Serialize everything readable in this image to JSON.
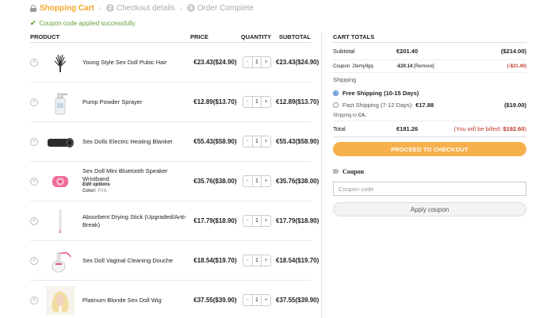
{
  "steps": [
    {
      "num": "1",
      "label": "Shopping Cart"
    },
    {
      "num": "2",
      "label": "Checkout details"
    },
    {
      "num": "3",
      "label": "Order Complete"
    }
  ],
  "step_separator": "›",
  "notice": "Coupon code applied successfully.",
  "cart": {
    "headers": {
      "product": "PRODUCT",
      "price": "PRICE",
      "quantity": "QUANTITY",
      "subtotal": "SUBTOTAL"
    },
    "items": [
      {
        "name": "Young Style Sex Doll Pubic Hair",
        "price": "€23.43($24.90)",
        "qty": "1",
        "subtotal": "€23.43($24.90)",
        "thumb_icon": "feather-tuft-icon"
      },
      {
        "name": "Pump Powder Sprayer",
        "price": "€12.89($13.70)",
        "qty": "1",
        "subtotal": "€12.89($13.70)",
        "thumb_icon": "spray-bottle-icon"
      },
      {
        "name": "Sex Dolls Electric Heating Blanket",
        "price": "€55.43($58.90)",
        "qty": "1",
        "subtotal": "€55.43($58.90)",
        "thumb_icon": "rolled-blanket-icon"
      },
      {
        "name": "Sex Doll Mini Bluetooth Speaker Wristband",
        "edit": "Edit options",
        "meta_label": "Color:",
        "meta_value": "Pink",
        "price": "€35.76($38.00)",
        "qty": "1",
        "subtotal": "€35.76($38.00)",
        "thumb_icon": "pink-wristband-icon"
      },
      {
        "name": "Absorbent Drying Stick (Upgraded/Anti-Break)",
        "price": "€17.79($18.90)",
        "qty": "1",
        "subtotal": "€17.79($18.90)",
        "thumb_icon": "drying-stick-icon"
      },
      {
        "name": "Sex Doll Vaginal Cleaning Douche",
        "price": "€18.54($19.70)",
        "qty": "1",
        "subtotal": "€18.54($19.70)",
        "thumb_icon": "douche-bottle-icon"
      },
      {
        "name": "Platinum Blonde Sex Doll Wig",
        "price": "€37.55($39.90)",
        "qty": "1",
        "subtotal": "€37.55($39.90)",
        "thumb_icon": "blonde-wig-icon"
      }
    ],
    "remove_symbol": "×",
    "minus": "-",
    "plus": "+"
  },
  "totals": {
    "title": "CART TOTALS",
    "subtotal_label": "Subtotal",
    "subtotal_value": "€201.40",
    "subtotal_usd": "($214.00)",
    "coupon_label": "Coupon: 2temy9gq",
    "coupon_value": "-€20.14",
    "coupon_remove": "[Remove]",
    "coupon_usd": "(-$21.40)",
    "shipping_label": "Shipping",
    "free_shipping": "Free Shipping (10-15 Days)",
    "fast_shipping_label": "Fast Shipping (7-12 Days):",
    "fast_shipping_value": "€17.88",
    "fast_shipping_usd": "($19.00)",
    "shipping_to_label": "Shipping to",
    "shipping_to_value": "CA.",
    "total_label": "Total",
    "total_value": "€181.26",
    "billed_label": "(You will be billed:",
    "billed_value": "$192.60",
    "billed_close": ")",
    "checkout_button": "PROCEED TO CHECKOUT",
    "coupon_title": "Coupon",
    "coupon_placeholder": "Coupon code",
    "apply_button": "Apply coupon"
  },
  "colors": {
    "accent": "#f3a52a",
    "success": "#6a9f3f",
    "checkout": "#f6b04c",
    "billed": "#c0392b"
  }
}
